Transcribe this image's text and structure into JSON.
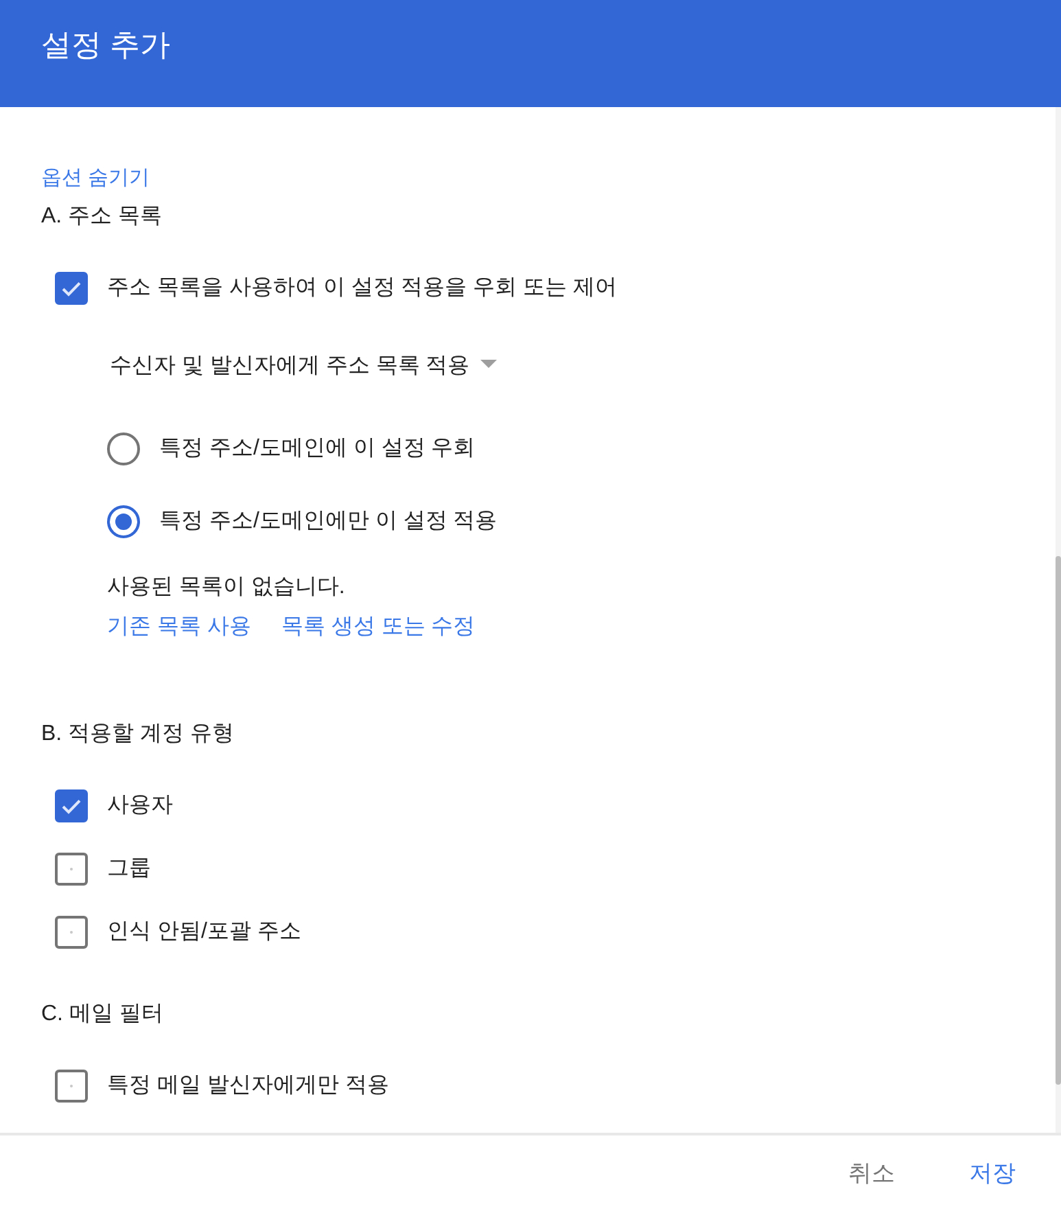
{
  "header": {
    "title": "설정 추가"
  },
  "options_link": {
    "label": "옵션 숨기기"
  },
  "sections": [
    {
      "heading": "A. 주소 목록",
      "checkboxes": [
        {
          "label": "주소 목록을 사용하여 이 설정 적용을 우회 또는 제어",
          "checked": true
        }
      ],
      "address_list": {
        "dropdown": {
          "value": "수신자 및 발신자에게 주소 목록 적용"
        },
        "radios": [
          {
            "label": "특정 주소/도메인에 이 설정 우회",
            "selected": false
          },
          {
            "label": "특정 주소/도메인에만 이 설정 적용",
            "selected": true
          }
        ],
        "status": "사용된 목록이 없습니다.",
        "links": [
          "기존 목록 사용",
          "목록 생성 또는 수정"
        ]
      }
    },
    {
      "heading": "B. 적용할 계정 유형",
      "checkboxes": [
        {
          "label": "사용자",
          "checked": true
        },
        {
          "label": "그룹",
          "checked": false
        },
        {
          "label": "인식 안됨/포괄 주소",
          "checked": false
        }
      ]
    },
    {
      "heading": "C. 메일 필터",
      "checkboxes": [
        {
          "label": "특정 메일 발신자에게만 적용",
          "checked": false
        }
      ]
    }
  ],
  "footer": {
    "buttons": [
      {
        "label": "취소",
        "kind": "secondary"
      },
      {
        "label": "저장",
        "kind": "primary"
      }
    ]
  }
}
